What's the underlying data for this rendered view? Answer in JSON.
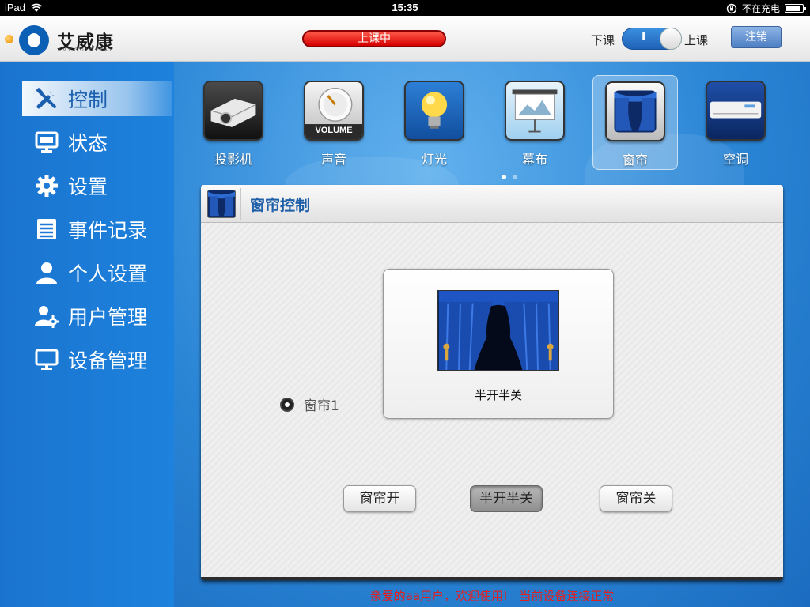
{
  "statusbar": {
    "device": "iPad",
    "time": "15:35",
    "charging": "不在充电",
    "battery_level": 0.85
  },
  "header": {
    "logo_name": "艾威康",
    "logo_sub": "AVCCDIGITAL",
    "class_status": "上课中",
    "toggle_left": "下课",
    "toggle_mark": "I",
    "toggle_right": "上课",
    "logout": "注销"
  },
  "sidebar": {
    "items": [
      {
        "label": "控制",
        "icon": "tools-icon"
      },
      {
        "label": "状态",
        "icon": "monitor-status-icon"
      },
      {
        "label": "设置",
        "icon": "gear-icon"
      },
      {
        "label": "事件记录",
        "icon": "list-icon"
      },
      {
        "label": "个人设置",
        "icon": "person-icon"
      },
      {
        "label": "用户管理",
        "icon": "user-gear-icon"
      },
      {
        "label": "设备管理",
        "icon": "desktop-icon"
      }
    ],
    "active_index": 0
  },
  "devices": {
    "items": [
      {
        "label": "投影机",
        "icon": "projector-icon"
      },
      {
        "label": "声音",
        "icon": "volume-knob-icon",
        "icon_text": "VOLUME"
      },
      {
        "label": "灯光",
        "icon": "lightbulb-icon"
      },
      {
        "label": "幕布",
        "icon": "screen-icon"
      },
      {
        "label": "窗帘",
        "icon": "curtain-icon"
      },
      {
        "label": "空调",
        "icon": "air-conditioner-icon"
      }
    ],
    "active_index": 4,
    "page": 1,
    "page_count": 2
  },
  "panel": {
    "title": "窗帘控制",
    "curtain_name": "窗帘1",
    "curtain_state": "半开半关",
    "buttons": {
      "open": "窗帘开",
      "half": "半开半关",
      "close": "窗帘关"
    }
  },
  "footer": {
    "message": "亲爱的aa用户，欢迎使用!   当前设备连接正常"
  },
  "colors": {
    "sidebar_blue": "#1d82dd",
    "status_red": "#d40000",
    "title_blue": "#1d5ea8",
    "footer_red": "#e02020"
  }
}
